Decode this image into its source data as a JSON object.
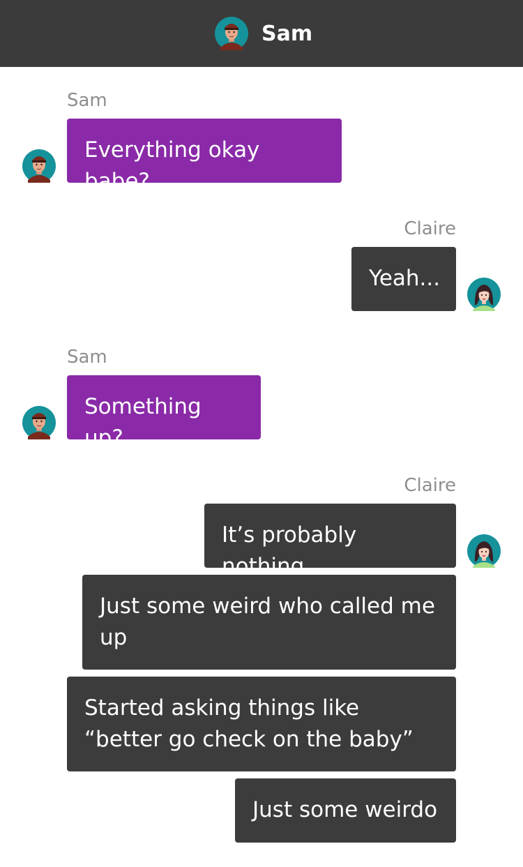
{
  "header": {
    "title": "Sam",
    "avatar_icon": "sam-avatar-icon"
  },
  "colors": {
    "header_bg": "#3b3b3b",
    "sam_bubble": "#8a2aa8",
    "claire_bubble": "#3c3c3c",
    "name_label": "#8e8e8e",
    "avatar_ring": "#15929a"
  },
  "messages": [
    {
      "sender": "Sam",
      "name_label": "Sam",
      "texts": [
        "Everything okay babe?"
      ]
    },
    {
      "sender": "Claire",
      "name_label": "Claire",
      "texts": [
        "Yeah..."
      ]
    },
    {
      "sender": "Sam",
      "name_label": "Sam",
      "texts": [
        "Something up?"
      ]
    },
    {
      "sender": "Claire",
      "name_label": "Claire",
      "texts": [
        "It’s probably nothing",
        "Just some weird who called me up",
        "Started asking things like “better go check on the baby”",
        "Just some weirdo"
      ]
    }
  ]
}
